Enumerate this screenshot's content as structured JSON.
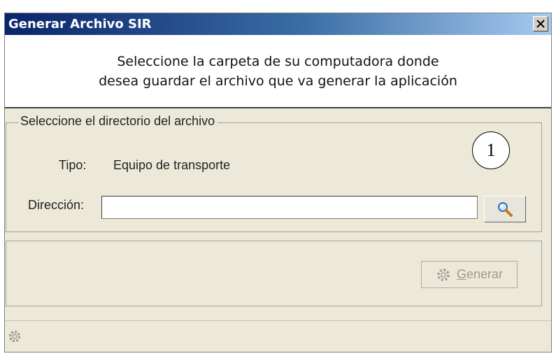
{
  "window": {
    "title": "Generar Archivo SIR",
    "close_glyph": "✕"
  },
  "header": {
    "line1": "Seleccione la carpeta de su computadora donde",
    "line2": "desea guardar el archivo que va generar la aplicación"
  },
  "directory_group": {
    "legend": "Seleccione el directorio del archivo",
    "tipo_label": "Tipo:",
    "tipo_value": "Equipo de transporte",
    "direccion_label": "Dirección:",
    "direccion_value": "",
    "browse_icon": "magnifier-icon"
  },
  "annotation": {
    "number": "1"
  },
  "actions": {
    "generate_prefix": "G",
    "generate_rest": "enerar",
    "generate_icon": "gear-icon",
    "generate_enabled": false
  },
  "statusbar": {
    "icon": "gear-icon"
  },
  "colors": {
    "title_start": "#0a246a",
    "title_end": "#a6caf0",
    "face": "#ece9d8",
    "disabled_text": "#9c9a90"
  }
}
